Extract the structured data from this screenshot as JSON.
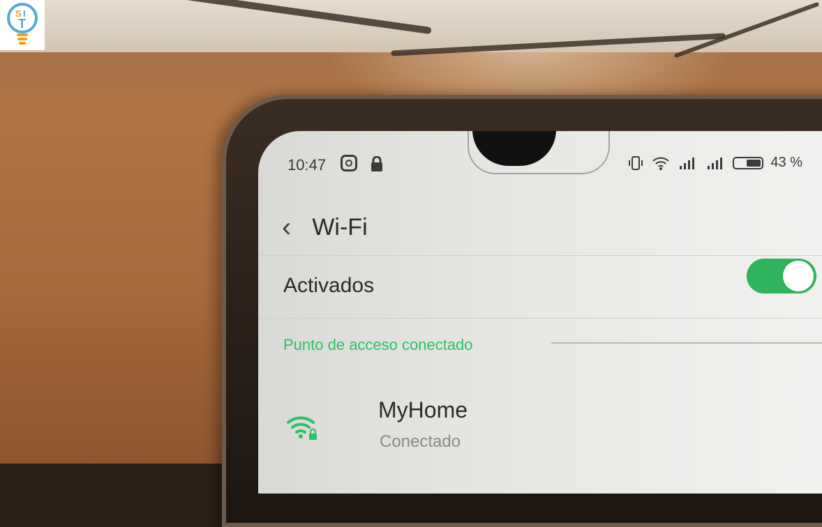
{
  "status_bar": {
    "time": "10:47",
    "battery": "43 %",
    "icons": [
      "instagram-icon",
      "lock-icon",
      "vibrate-icon",
      "wifi-icon",
      "signal-icon",
      "signal-icon",
      "battery-icon"
    ]
  },
  "header": {
    "back_icon": "chevron-left-icon",
    "title": "Wi-Fi"
  },
  "wifi_toggle": {
    "label": "Activados",
    "state": "on"
  },
  "section": {
    "title": "Punto de acceso conectado"
  },
  "network": {
    "name": "MyHome",
    "status": "Conectado",
    "icon": "wifi-lock-icon"
  },
  "logo": {
    "text": "SIT"
  },
  "colors": {
    "accent": "#29c267",
    "toggle_on": "#2fb35b"
  }
}
